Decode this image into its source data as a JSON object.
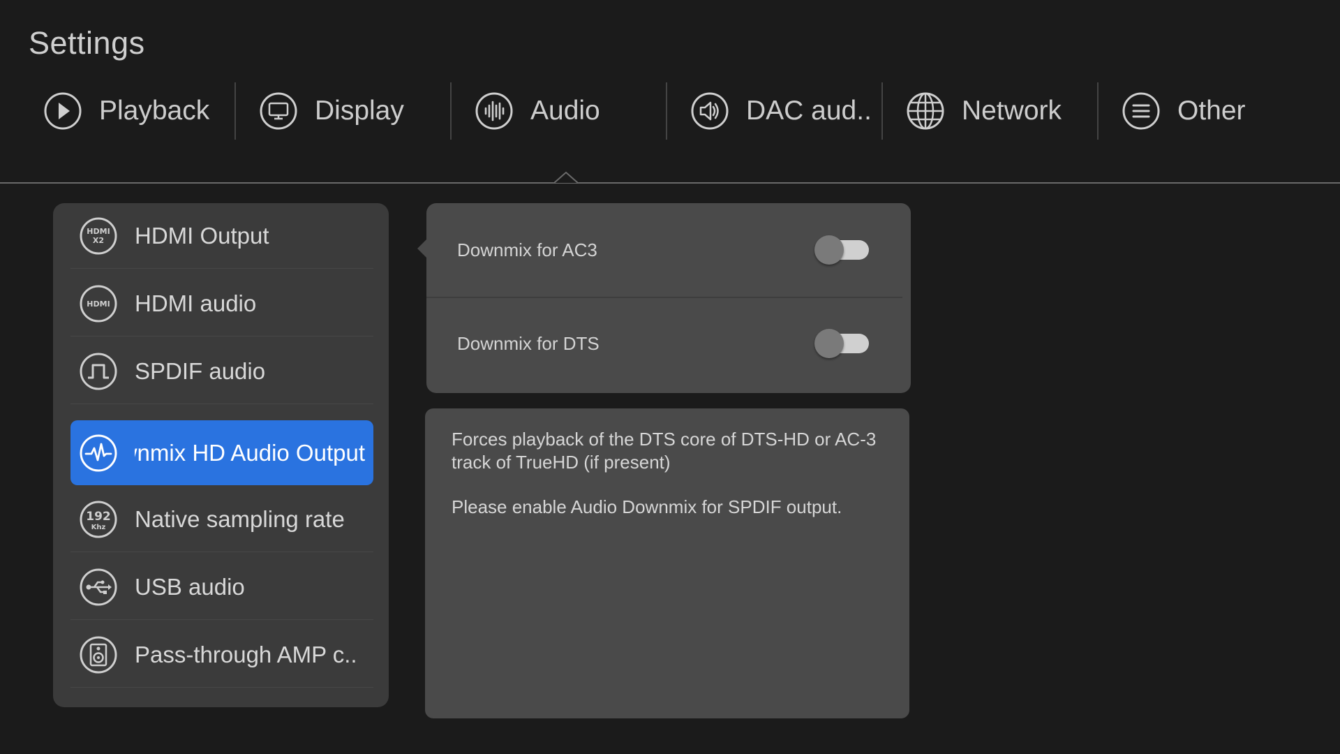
{
  "header": {
    "title": "Settings"
  },
  "tabs": [
    {
      "label": "Playback",
      "icon": "play-circle-icon"
    },
    {
      "label": "Display",
      "icon": "monitor-icon"
    },
    {
      "label": "Audio",
      "icon": "waveform-icon",
      "active": true
    },
    {
      "label": "DAC aud..",
      "icon": "speaker-icon"
    },
    {
      "label": "Network",
      "icon": "globe-icon"
    },
    {
      "label": "Other",
      "icon": "menu-icon"
    }
  ],
  "sidebar": {
    "items": [
      {
        "label": "HDMI Output",
        "icon": "hdmi-x2-icon",
        "icon_text": [
          "HDMI",
          "X2"
        ]
      },
      {
        "label": "HDMI audio",
        "icon": "hdmi-icon",
        "icon_text": [
          "HDMI"
        ]
      },
      {
        "label": "SPDIF audio",
        "icon": "spdif-wave-icon"
      },
      {
        "label": "Downmix HD Audio Output",
        "icon": "pulse-icon",
        "active": true
      },
      {
        "label": "Native sampling rate",
        "icon": "sampling-rate-icon",
        "icon_text": [
          "192",
          "Khz"
        ]
      },
      {
        "label": "USB audio",
        "icon": "usb-icon"
      },
      {
        "label": "Pass-through AMP c..",
        "icon": "amp-speaker-icon"
      }
    ]
  },
  "options": [
    {
      "label": "Downmix for AC3",
      "enabled": false
    },
    {
      "label": "Downmix for DTS",
      "enabled": false
    }
  ],
  "description": {
    "lines": [
      "Forces playback of the DTS core of DTS-HD or AC-3 track of TrueHD (if present)",
      "Please enable Audio Downmix for SPDIF output."
    ]
  },
  "colors": {
    "accent": "#2a73e0",
    "background": "#1b1b1b",
    "panel": "#3b3b3b",
    "panel_light": "#4a4a4a"
  }
}
